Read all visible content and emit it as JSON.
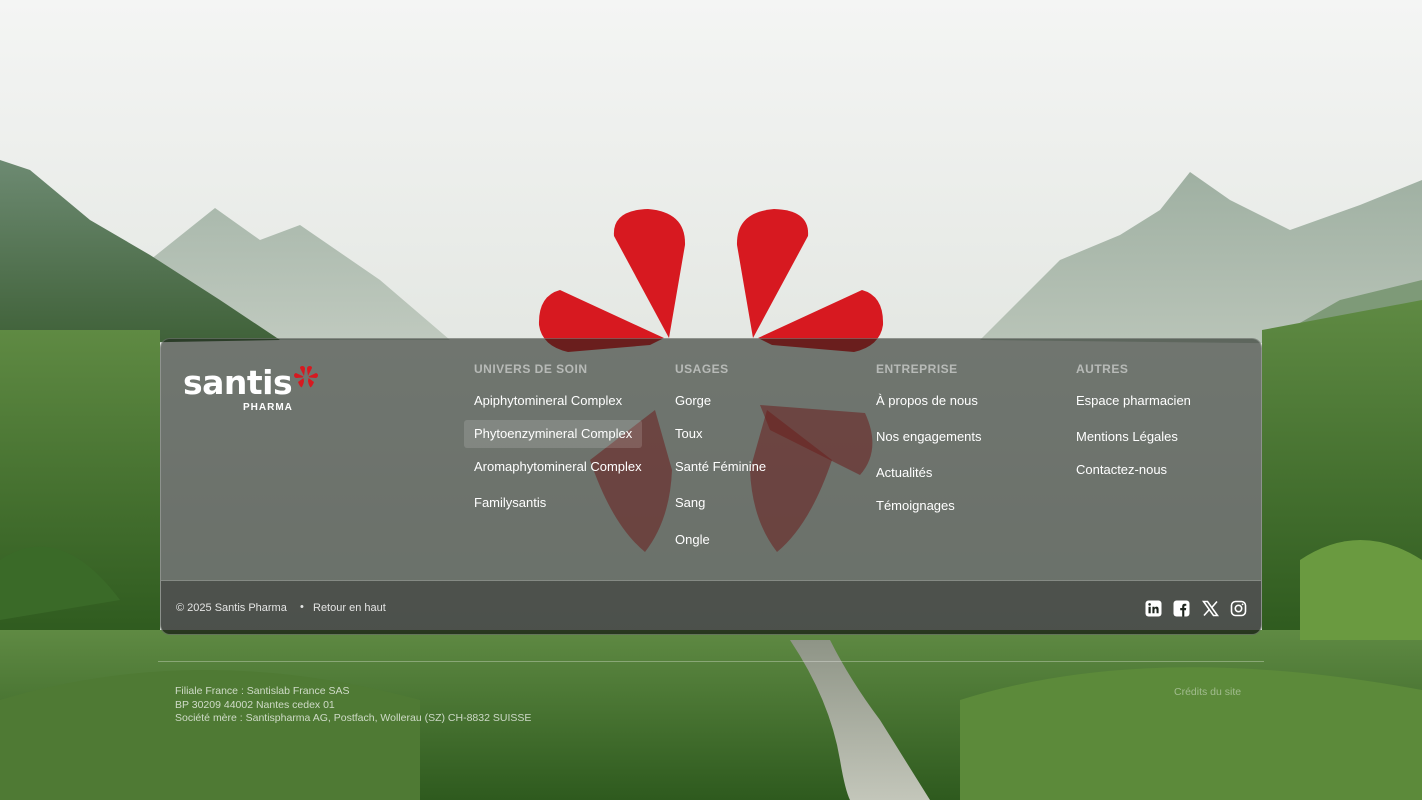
{
  "brand": {
    "name": "santis",
    "subname": "PHARMA",
    "accent_color": "#d71920"
  },
  "columns": [
    {
      "heading": "UNIVERS DE SOIN",
      "links": [
        "Apiphytomineral Complex",
        "Phytoenzymineral Complex",
        "Aromaphytomineral Complex",
        "Familysantis"
      ],
      "highlighted": 1
    },
    {
      "heading": "USAGES",
      "links": [
        "Gorge",
        "Toux",
        "Santé Féminine",
        "Sang",
        "Ongle"
      ]
    },
    {
      "heading": "ENTREPRISE",
      "links": [
        "À propos de nous",
        "Nos engagements",
        "Actualités",
        "Témoignages"
      ]
    },
    {
      "heading": "AUTRES",
      "links": [
        "Espace pharmacien",
        "Mentions Légales",
        "Contactez-nous"
      ]
    }
  ],
  "bottom_bar": {
    "copyright": "© 2025 Santis Pharma",
    "separator": "•",
    "back_to_top": "Retour en haut",
    "social_icons": [
      "linkedin-icon",
      "facebook-icon",
      "x-icon",
      "instagram-icon"
    ]
  },
  "legal": {
    "line1": "Filiale France : Santislab France SAS",
    "line2": "BP 30209 44002 Nantes cedex 01",
    "line3": "Société mère : Santispharma AG, Postfach, Wollerau (SZ) CH-8832 SUISSE"
  },
  "credits": "Crédits du site"
}
